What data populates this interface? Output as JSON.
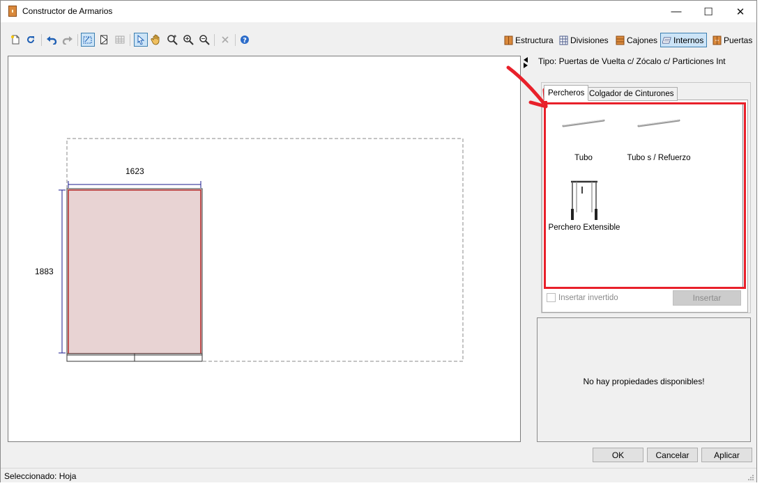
{
  "window": {
    "title": "Constructor de Armarios",
    "minimize_glyph": "—",
    "maximize_glyph": "☐",
    "close_glyph": "✕"
  },
  "toolbar": {
    "tools": [
      "new-icon",
      "refresh-icon",
      "undo-icon",
      "redo-icon",
      "select-shape-icon",
      "door-icon",
      "grid-icon",
      "pointer-icon",
      "pan-hand-icon",
      "zoom-fit-icon",
      "zoom-in-icon",
      "zoom-out-icon",
      "delete-icon",
      "help-icon"
    ],
    "modes": [
      {
        "label": "Estructura",
        "icon": "wardrobe-icon",
        "active": false
      },
      {
        "label": "Divisiones",
        "icon": "grid-icon",
        "active": false
      },
      {
        "label": "Cajones",
        "icon": "drawers-icon",
        "active": false
      },
      {
        "label": "Internos",
        "icon": "interior-icon",
        "active": true
      },
      {
        "label": "Puertas",
        "icon": "door-icon",
        "active": false
      }
    ]
  },
  "canvas": {
    "width_label": "1623",
    "height_label": "1883",
    "panel_fill": "#e8d3d3",
    "edge_color": "#b22222",
    "dimension_color": "#1a1a8c"
  },
  "panel": {
    "tipo": "Tipo: Puertas de Vuelta c/ Zócalo c/ Particiones Int",
    "tabs": [
      "Percheros",
      "Colgador de Cinturones"
    ],
    "active_tab": "Percheros",
    "items": [
      {
        "label": "Tubo",
        "icon": "tube-icon"
      },
      {
        "label": "Tubo s / Refuerzo",
        "icon": "tube-icon"
      },
      {
        "label": "Perchero Extensible",
        "icon": "pull-down-rail-icon"
      }
    ],
    "insert_inverted_label": "Insertar invertido",
    "insert_button": "Insertar",
    "properties_message": "No hay propiedades disponibles!",
    "highlight_color": "#e8202a"
  },
  "dialog": {
    "ok": "OK",
    "cancel": "Cancelar",
    "apply": "Aplicar"
  },
  "status": {
    "text": "Seleccionado: Hoja"
  }
}
